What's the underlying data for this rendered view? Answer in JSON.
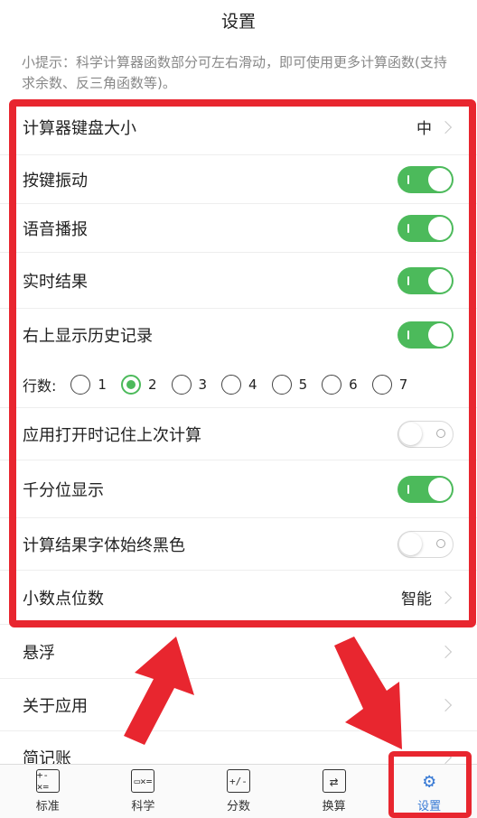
{
  "header": {
    "title": "设置"
  },
  "hint": "小提示：科学计算器函数部分可左右滑动，即可使用更多计算函数(支持求余数、反三角函数等)。",
  "settings": {
    "keyboard_size": {
      "label": "计算器键盘大小",
      "value": "中"
    },
    "vibration": {
      "label": "按键振动",
      "on": true
    },
    "voice": {
      "label": "语音播报",
      "on": true
    },
    "realtime": {
      "label": "实时结果",
      "on": true
    },
    "history": {
      "label": "右上显示历史记录",
      "on": true
    },
    "rows": {
      "label": "行数:",
      "options": [
        "1",
        "2",
        "3",
        "4",
        "5",
        "6",
        "7"
      ],
      "selected": "2"
    },
    "remember": {
      "label": "应用打开时记住上次计算",
      "on": false
    },
    "thousands": {
      "label": "千分位显示",
      "on": true
    },
    "black_font": {
      "label": "计算结果字体始终黑色",
      "on": false
    },
    "decimals": {
      "label": "小数点位数",
      "value": "智能"
    },
    "float": {
      "label": "悬浮"
    },
    "about": {
      "label": "关于应用"
    },
    "notes": {
      "label": "简记账"
    }
  },
  "tabs": [
    {
      "label": "标准",
      "icon": "standard-calc-icon",
      "glyph": "+-×="
    },
    {
      "label": "科学",
      "icon": "scientific-calc-icon",
      "glyph": "▭×="
    },
    {
      "label": "分数",
      "icon": "fraction-icon",
      "glyph": "+/-"
    },
    {
      "label": "换算",
      "icon": "convert-icon",
      "glyph": "⇄"
    },
    {
      "label": "设置",
      "icon": "settings-gear-icon",
      "glyph": "⚙"
    }
  ],
  "colors": {
    "accent_green": "#4cba5b",
    "annotation_red": "#e8262f",
    "active_tab_blue": "#3a7bd5"
  }
}
